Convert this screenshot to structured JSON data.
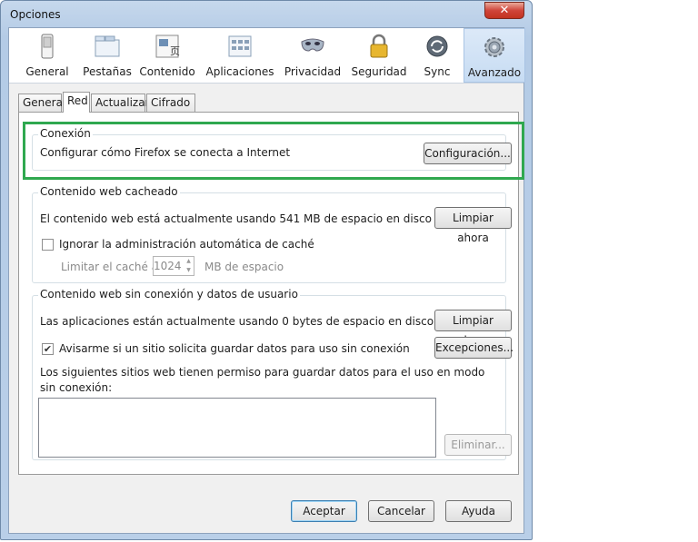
{
  "window": {
    "title": "Opciones",
    "close_glyph": "✕"
  },
  "toolbar": [
    {
      "label": "General",
      "icon": "general-switch-icon"
    },
    {
      "label": "Pestañas",
      "icon": "tabs-icon"
    },
    {
      "label": "Contenido",
      "icon": "content-icon"
    },
    {
      "label": "Aplicaciones",
      "icon": "applications-icon"
    },
    {
      "label": "Privacidad",
      "icon": "privacy-mask-icon"
    },
    {
      "label": "Seguridad",
      "icon": "padlock-icon"
    },
    {
      "label": "Sync",
      "icon": "sync-icon"
    },
    {
      "label": "Avanzado",
      "icon": "gear-icon"
    }
  ],
  "tabs": [
    "General",
    "Red",
    "Actualizar",
    "Cifrado"
  ],
  "connection": {
    "title": "Conexión",
    "text": "Configurar cómo Firefox se conecta a Internet",
    "button": "Configuración..."
  },
  "cache": {
    "title": "Contenido web cacheado",
    "text": "El contenido web está actualmente usando 541 MB de espacio en disco",
    "button": "Limpiar ahora",
    "checkbox_label": "Ignorar la administración automática de caché",
    "limit_label": "Limitar el caché a",
    "limit_value": "1024",
    "limit_unit": "MB de espacio"
  },
  "offline": {
    "title": "Contenido web sin conexión y datos de usuario",
    "text": "Las aplicaciones están actualmente usando 0 bytes de espacio en disco de caché",
    "button": "Limpiar ahora",
    "checkbox_label": "Avisarme si un sitio solicita guardar datos para uso sin conexión",
    "exceptions_button": "Excepciones...",
    "allowed_text_1": "Los siguientes sitios web tienen permiso para guardar datos para el uso en modo",
    "allowed_text_2": "sin conexión:",
    "remove_button": "Eliminar..."
  },
  "footer": {
    "accept": "Aceptar",
    "cancel": "Cancelar",
    "help": "Ayuda"
  },
  "colors": {
    "highlight": "#2fa84f"
  }
}
